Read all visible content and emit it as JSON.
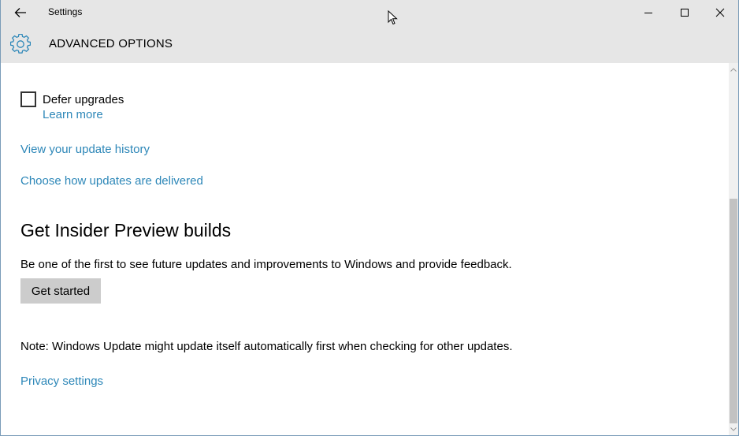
{
  "window": {
    "title": "Settings",
    "controls": {
      "back": "back-arrow",
      "minimize": "minimize",
      "maximize": "maximize",
      "close": "close"
    }
  },
  "header": {
    "icon": "gear-icon",
    "title": "ADVANCED OPTIONS"
  },
  "content": {
    "defer": {
      "label": "Defer upgrades",
      "checked": false,
      "learn_more": "Learn more"
    },
    "links": {
      "history": "View your update history",
      "delivery": "Choose how updates are delivered",
      "privacy": "Privacy settings"
    },
    "insider": {
      "title": "Get Insider Preview builds",
      "description": "Be one of the first to see future updates and improvements to Windows and provide feedback.",
      "button": "Get started"
    },
    "note": "Note: Windows Update might update itself automatically first when checking for other updates."
  },
  "colors": {
    "accent": "#2d87b8",
    "titlebar": "#e6e6e6",
    "button": "#cccccc"
  }
}
